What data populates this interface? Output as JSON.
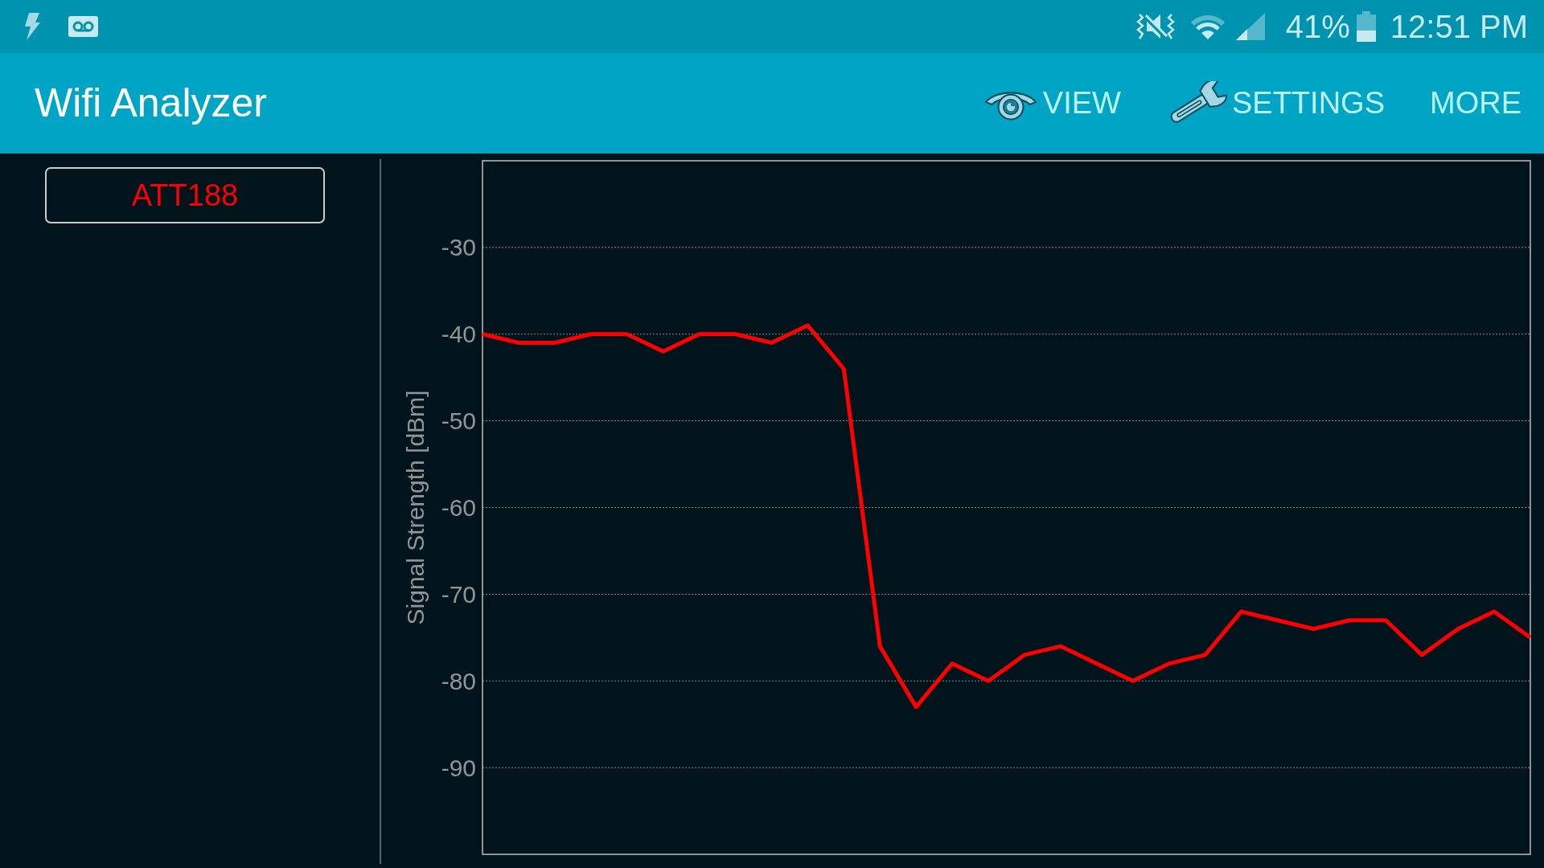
{
  "status_bar": {
    "battery": "41%",
    "time": "12:51 PM"
  },
  "app_bar": {
    "title": "Wifi Analyzer",
    "actions": [
      {
        "kind": "view",
        "label": "VIEW"
      },
      {
        "kind": "settings",
        "label": "SETTINGS"
      },
      {
        "kind": "more",
        "label": "MORE"
      }
    ]
  },
  "networks": [
    {
      "ssid": "ATT188",
      "color": "#ff0000"
    }
  ],
  "signal_graph": {
    "chart_data": {
      "type": "line",
      "ylabel": "Signal Strength [dBm]",
      "ylim": [
        -100,
        -20
      ],
      "yticks": [
        -90,
        -80,
        -70,
        -60,
        -50,
        -40,
        -30
      ],
      "grid": true,
      "series": [
        {
          "color": "#ff0000",
          "values": [
            -40,
            -41,
            -41,
            -40,
            -40,
            -42,
            -40,
            -40,
            -41,
            -39,
            -44,
            -76,
            -83,
            -78,
            -80,
            -77,
            -76,
            -78,
            -80,
            -78,
            -77,
            -72,
            -73,
            -74,
            -73,
            -73,
            -77,
            -74,
            -72,
            -75
          ]
        }
      ]
    }
  }
}
